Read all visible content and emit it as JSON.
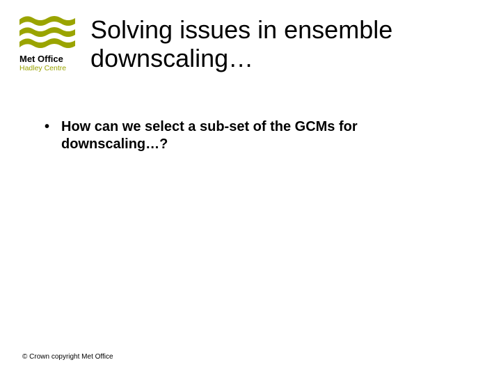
{
  "logo": {
    "line1": "Met Office",
    "line2": "Hadley Centre",
    "wave_color": "#9aa400"
  },
  "title": "Solving issues in ensemble downscaling…",
  "bullets": [
    "How can we select a sub-set of the GCMs for downscaling…?"
  ],
  "footer": "© Crown copyright   Met Office"
}
